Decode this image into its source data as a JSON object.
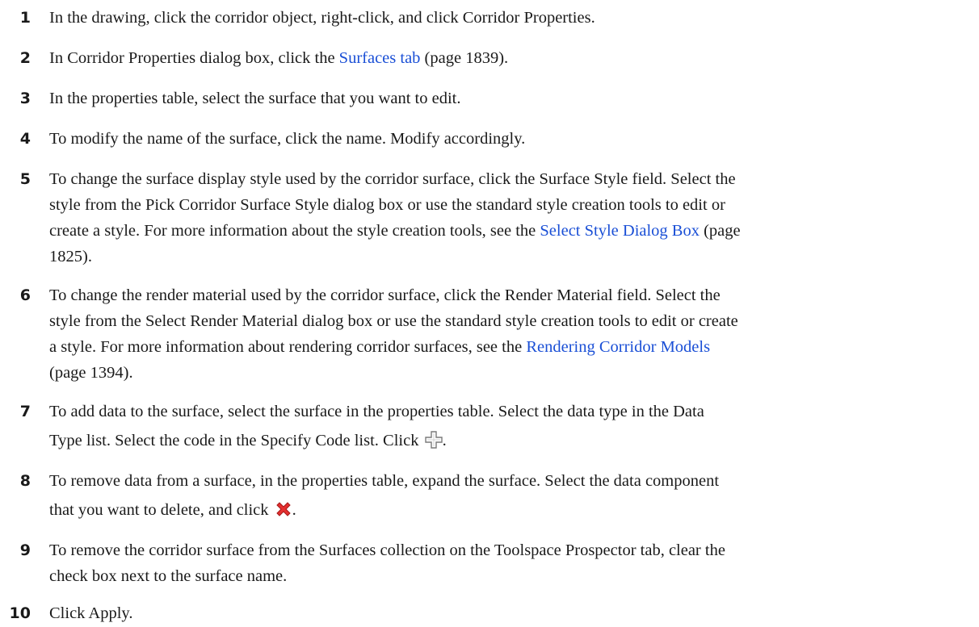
{
  "steps": [
    {
      "num": "1",
      "text": "In the drawing, click the corridor object, right-click, and click Corridor Properties."
    },
    {
      "num": "2",
      "pre": "In Corridor Properties dialog box, click the ",
      "link": "Surfaces tab",
      "post": " (page 1839)."
    },
    {
      "num": "3",
      "text": "In the properties table, select the surface that you want to edit."
    },
    {
      "num": "4",
      "text": "To modify the name of the surface, click the name. Modify accordingly."
    },
    {
      "num": "5",
      "l1": "To change the surface display style used by the corridor surface, click the Surface Style field. Select the",
      "l2": "style from the Pick Corridor Surface Style dialog box or use the standard style creation tools to edit or",
      "l3_pre": "create a style. For more information about the style creation tools, see the ",
      "l3_link": "Select Style Dialog Box",
      "l3_post": " (page",
      "l4": "1825)."
    },
    {
      "num": "6",
      "l1": "To change the render material used by the corridor surface, click the Render Material field. Select the",
      "l2": "style from the Select Render Material dialog box or use the standard style creation tools to edit or create",
      "l3_pre": "a style. For more information about rendering corridor surfaces, see the ",
      "l3_link": "Rendering Corridor Models",
      "l4": "(page 1394)."
    },
    {
      "num": "7",
      "l1": "To add data to the surface, select the surface in the properties table. Select the data type in the Data",
      "l2_pre": "Type list. Select the code in the Specify Code list. Click ",
      "l2_post": "."
    },
    {
      "num": "8",
      "l1": "To remove data from a surface, in the properties table, expand the surface. Select the data component",
      "l2_pre": "that you want to delete, and click ",
      "l2_post": "."
    },
    {
      "num": "9",
      "l1": "To remove the corridor surface from the Surfaces collection on the Toolspace Prospector tab, clear the",
      "l2": "check box next to the surface name."
    },
    {
      "num": "10",
      "text": "Click Apply."
    }
  ]
}
